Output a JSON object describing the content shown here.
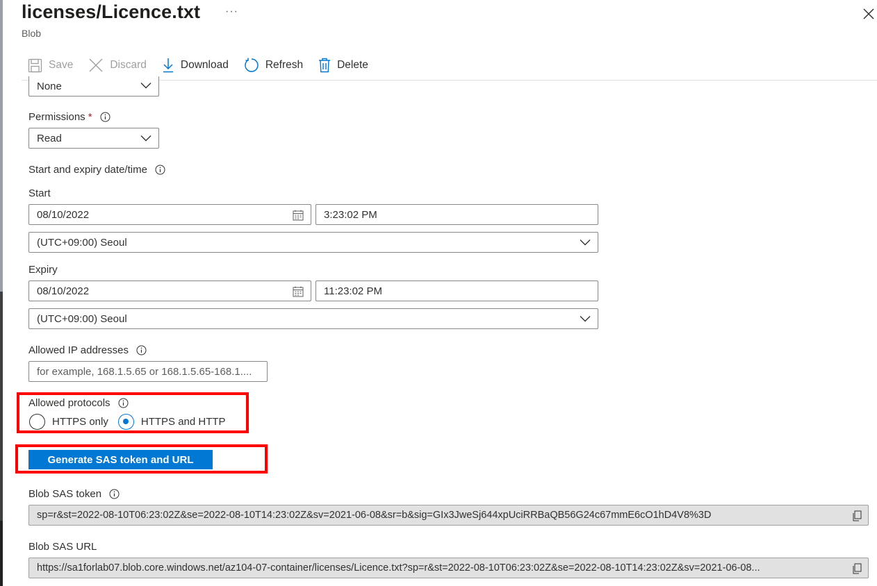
{
  "header": {
    "title": "licenses/Licence.txt",
    "more": "···",
    "subtitle": "Blob"
  },
  "toolbar": {
    "save_label": "Save",
    "discard_label": "Discard",
    "download_label": "Download",
    "refresh_label": "Refresh",
    "delete_label": "Delete"
  },
  "form": {
    "stored_policy_value": "None",
    "permissions": {
      "label": "Permissions",
      "required_mark": "*",
      "value": "Read"
    },
    "date_section_label": "Start and expiry date/time",
    "start": {
      "label": "Start",
      "date": "08/10/2022",
      "time": "3:23:02 PM",
      "timezone": "(UTC+09:00) Seoul"
    },
    "expiry": {
      "label": "Expiry",
      "date": "08/10/2022",
      "time": "11:23:02 PM",
      "timezone": "(UTC+09:00) Seoul"
    },
    "allowed_ip": {
      "label": "Allowed IP addresses",
      "value": "",
      "placeholder": "for example, 168.1.5.65 or 168.1.5.65-168.1...."
    },
    "allowed_protocols": {
      "label": "Allowed protocols",
      "options": [
        "HTTPS only",
        "HTTPS and HTTP"
      ],
      "selected": "HTTPS and HTTP"
    },
    "generate_button": "Generate SAS token and URL",
    "sas_token": {
      "label": "Blob SAS token",
      "value": "sp=r&st=2022-08-10T06:23:02Z&se=2022-08-10T14:23:02Z&sv=2021-06-08&sr=b&sig=GIx3JweSj644xpUciRRBaQB56G24c67mmE6cO1hD4V8%3D"
    },
    "sas_url": {
      "label": "Blob SAS URL",
      "value": "https://sa1forlab07.blob.core.windows.net/az104-07-container/licenses/Licence.txt?sp=r&st=2022-08-10T06:23:02Z&se=2022-08-10T14:23:02Z&sv=2021-06-08..."
    }
  },
  "colors": {
    "accent": "#0078d4",
    "highlight": "#ff0000",
    "required": "#a4262c"
  },
  "icons": [
    "save-icon",
    "discard-icon",
    "download-icon",
    "refresh-icon",
    "delete-icon",
    "close-icon",
    "info-icon",
    "chevron-down-icon",
    "calendar-icon",
    "copy-icon"
  ]
}
